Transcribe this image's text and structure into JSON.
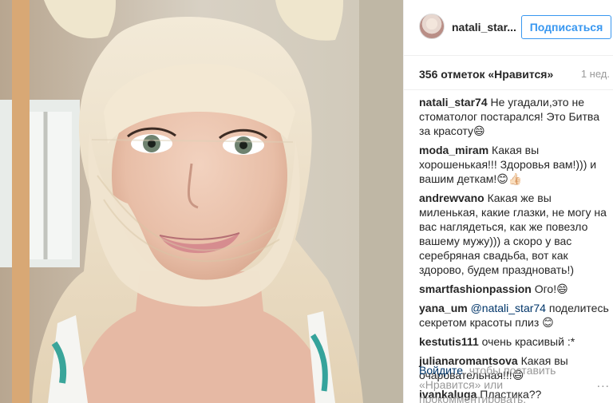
{
  "post": {
    "username": "natali_star...",
    "follow_label": "Подписаться",
    "likes": "356 отметок «Нравится»",
    "time": "1 нед.",
    "more": "..."
  },
  "comments": [
    {
      "user": "natali_star74",
      "text": " Не угадали,это не стоматолог постарался! Это Битва за красоту😄"
    },
    {
      "user": "moda_miram",
      "text": " Какая вы хорошенькая!!! Здоровья вам!))) и вашим деткам!😊👍🏻"
    },
    {
      "user": "andrewvano",
      "text": " Какая же вы миленькая, какие глазки, не могу на вас наглядеться, как же повезло вашему мужу))) а скоро у вас серебряная свадьба, вот как здорово, будем праздновать!)"
    },
    {
      "user": "smartfashionpassion",
      "text": " Ого!😄"
    },
    {
      "user": "yana_um",
      "mention": " @natali_star74",
      "text": " поделитесь секретом красоты плиз 😊"
    },
    {
      "user": "kestutis111",
      "text": " очень красивый :*"
    },
    {
      "user": "julianaromantsova",
      "text": " Какая вы очаровательная!!!😄"
    },
    {
      "user": "ivankaluga",
      "text": " Пластика??"
    }
  ],
  "login": {
    "link": "Войдите",
    "text": ", чтобы поставить «Нравится» или прокомментировать."
  },
  "colors": {
    "link_blue": "#3897f0",
    "dark_link": "#003569",
    "muted": "#999999"
  }
}
